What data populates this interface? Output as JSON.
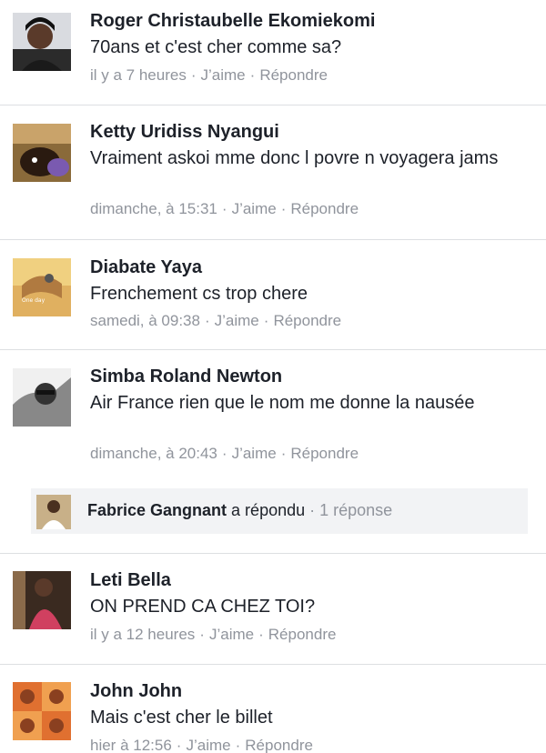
{
  "comments": [
    {
      "author": "Roger Christaubelle Ekomiekomi",
      "text": "70ans et c'est cher comme sa?",
      "time": "il y a 7 heures",
      "like": "J’aime",
      "reply": "Répondre"
    },
    {
      "author": "Ketty Uridiss Nyangui",
      "text": "Vraiment askoi mme donc l povre n voyagera jams",
      "time": "dimanche, à 15:31",
      "like": "J’aime",
      "reply": "Répondre"
    },
    {
      "author": "Diabate Yaya",
      "text": "Frenchement cs trop chere",
      "time": "samedi, à 09:38",
      "like": "J’aime",
      "reply": "Répondre"
    },
    {
      "author": "Simba Roland Newton",
      "text": "Air France rien que le nom me donne la nausée",
      "time": "dimanche, à 20:43",
      "like": "J’aime",
      "reply": "Répondre",
      "replies": {
        "author": "Fabrice Gangnant",
        "action": "a répondu",
        "count": "1 réponse"
      }
    },
    {
      "author": "Leti Bella",
      "text": "ON PREND CA CHEZ TOI?",
      "time": "il y a 12 heures",
      "like": "J’aime",
      "reply": "Répondre"
    },
    {
      "author": "John John",
      "text": "Mais c'est cher le billet",
      "time": "hier à 12:56",
      "like": "J’aime",
      "reply": "Répondre"
    }
  ],
  "avatar_3_caption": "One day",
  "separator": "·"
}
